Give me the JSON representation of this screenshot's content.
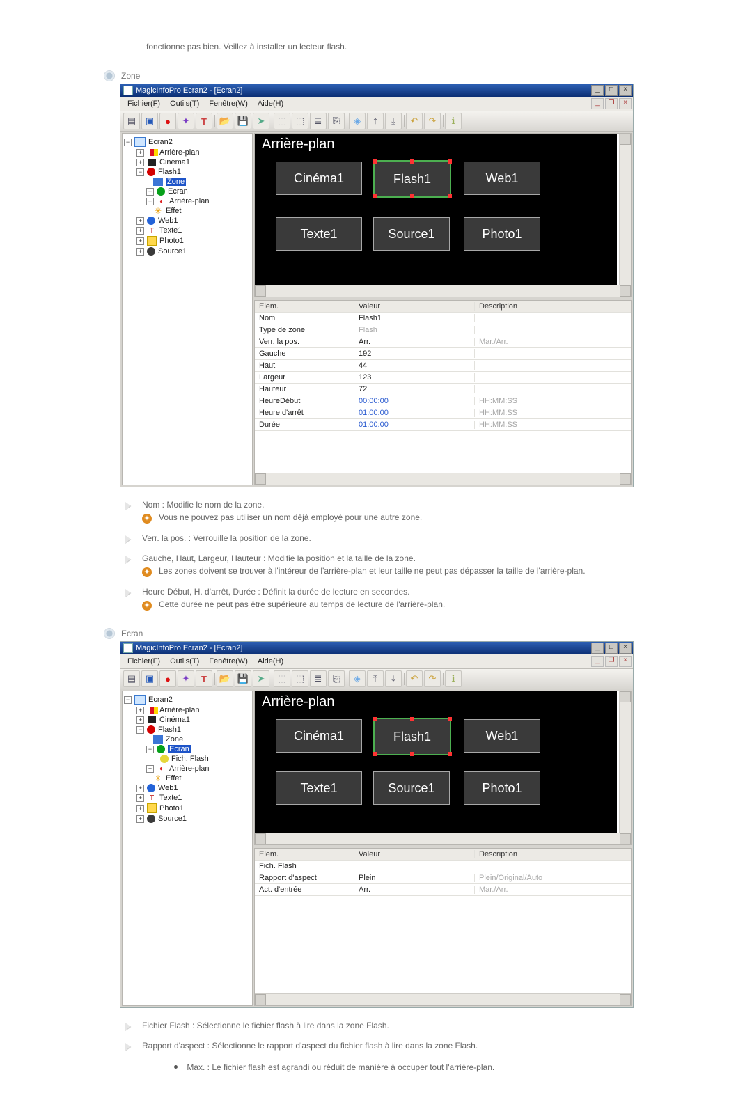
{
  "intro": "fonctionne pas bien. Veillez à installer un lecteur flash.",
  "sections": {
    "zone": "Zone",
    "ecran": "Ecran"
  },
  "app": {
    "title": "MagicInfoPro Ecran2 - [Ecran2]",
    "menu": {
      "fichier": "Fichier(F)",
      "outils": "Outils(T)",
      "fenetre": "Fenêtre(W)",
      "aide": "Aide(H)"
    }
  },
  "tree_zone": {
    "root": "Ecran2",
    "bg": "Arrière-plan",
    "cinema": "Cinéma1",
    "flash": "Flash1",
    "zone": "Zone",
    "ecran": "Ecran",
    "bg2": "Arrière-plan",
    "effet": "Effet",
    "web": "Web1",
    "texte": "Texte1",
    "photo": "Photo1",
    "source": "Source1"
  },
  "tree_ecran": {
    "root": "Ecran2",
    "bg": "Arrière-plan",
    "cinema": "Cinéma1",
    "flash": "Flash1",
    "zone": "Zone",
    "ecran": "Ecran",
    "fichflash": "Fich. Flash",
    "bg2": "Arrière-plan",
    "effet": "Effet",
    "web": "Web1",
    "texte": "Texte1",
    "photo": "Photo1",
    "source": "Source1"
  },
  "canvas": {
    "bg_label": "Arrière-plan",
    "cinema": "Cinéma1",
    "flash": "Flash1",
    "web": "Web1",
    "texte": "Texte1",
    "source": "Source1",
    "photo": "Photo1"
  },
  "zone_props_header": {
    "c1": "Elem.",
    "c2": "Valeur",
    "c3": "Description"
  },
  "zone_props": [
    {
      "c1": "Nom",
      "c2": "Flash1",
      "c3": ""
    },
    {
      "c1": "Type de zone",
      "c2": "Flash",
      "c3": "",
      "c2dim": true
    },
    {
      "c1": "Verr. la pos.",
      "c2": "Arr.",
      "c3": "Mar./Arr.",
      "c3dim": true
    },
    {
      "c1": "Gauche",
      "c2": "192",
      "c3": ""
    },
    {
      "c1": "Haut",
      "c2": "44",
      "c3": ""
    },
    {
      "c1": "Largeur",
      "c2": "123",
      "c3": ""
    },
    {
      "c1": "Hauteur",
      "c2": "72",
      "c3": ""
    },
    {
      "c1": "HeureDébut",
      "c2": "00:00:00",
      "c3": "HH:MM:SS",
      "c2blue": true,
      "c3dim": true
    },
    {
      "c1": "Heure d'arrêt",
      "c2": "01:00:00",
      "c3": "HH:MM:SS",
      "c2blue": true,
      "c3dim": true
    },
    {
      "c1": "Durée",
      "c2": "01:00:00",
      "c3": "HH:MM:SS",
      "c2blue": true,
      "c3dim": true
    }
  ],
  "ecran_props": [
    {
      "c1": "Fich. Flash",
      "c2": "",
      "c3": ""
    },
    {
      "c1": "Rapport d'aspect",
      "c2": "Plein",
      "c3": "Plein/Original/Auto",
      "c3dim": true
    },
    {
      "c1": "Act. d'entrée",
      "c2": "Arr.",
      "c3": "Mar./Arr.",
      "c3dim": true
    }
  ],
  "bullets_zone": {
    "b1": "Nom : Modifie le nom de la zone.",
    "b1n": "Vous ne pouvez pas utiliser un nom déjà employé pour une autre zone.",
    "b2": "Verr. la pos. : Verrouille la position de la zone.",
    "b3": "Gauche, Haut, Largeur, Hauteur : Modifie la position et la taille de la zone.",
    "b3n": "Les zones doivent se trouver à l'intéreur de l'arrière-plan et leur taille ne peut pas dépasser la taille de l'arrière-plan.",
    "b4": "Heure Début, H. d'arrêt, Durée : Définit la durée de lecture en secondes.",
    "b4n": "Cette durée ne peut pas être supérieure au temps de lecture de l'arrière-plan."
  },
  "bullets_ecran": {
    "b1": "Fichier Flash : Sélectionne le fichier flash à lire dans la zone Flash.",
    "b2": "Rapport d'aspect : Sélectionne le rapport d'aspect du fichier flash à lire dans la zone Flash.",
    "max": "Max. : Le fichier flash est agrandi ou réduit de manière à occuper tout l'arrière-plan."
  }
}
